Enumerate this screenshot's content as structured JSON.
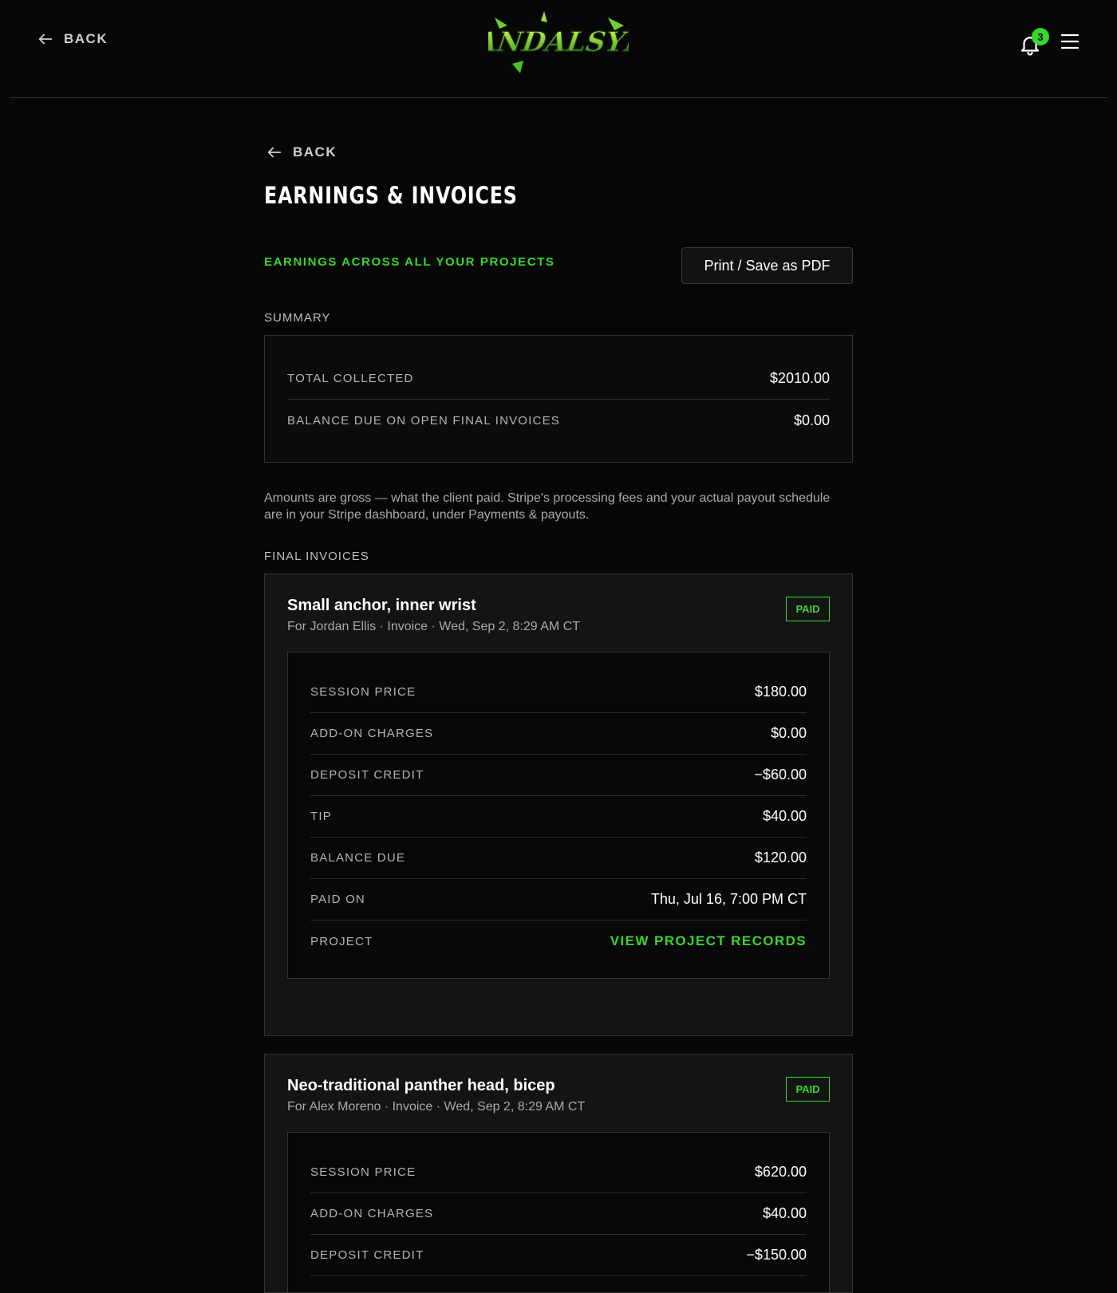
{
  "header": {
    "back_label": "BACK",
    "logo_text": "VANDALSYN",
    "notification_count": "3",
    "accent_color": "#39d531"
  },
  "page": {
    "back_label": "BACK",
    "title": "EARNINGS & INVOICES",
    "subtitle": "EARNINGS ACROSS ALL YOUR PROJECTS",
    "print_label": "Print / Save as PDF",
    "summary_label": "SUMMARY",
    "summary": [
      {
        "label": "TOTAL COLLECTED",
        "value": "$2010.00"
      },
      {
        "label": "BALANCE DUE ON OPEN FINAL INVOICES",
        "value": "$0.00"
      }
    ],
    "note": "Amounts are gross — what the client paid. Stripe's processing fees and your actual payout schedule are in your Stripe dashboard, under Payments & payouts.",
    "final_invoices_label": "FINAL INVOICES"
  },
  "invoices": [
    {
      "title": "Small anchor, inner wrist",
      "meta": "For Jordan Ellis · Invoice · Wed, Sep 2, 8:29 AM CT",
      "status": "PAID",
      "rows": [
        {
          "label": "SESSION PRICE",
          "value": "$180.00"
        },
        {
          "label": "ADD-ON CHARGES",
          "value": "$0.00"
        },
        {
          "label": "DEPOSIT CREDIT",
          "value": "−$60.00"
        },
        {
          "label": "TIP",
          "value": "$40.00"
        },
        {
          "label": "BALANCE DUE",
          "value": "$120.00"
        },
        {
          "label": "PAID ON",
          "value": "Thu, Jul 16, 7:00 PM CT"
        },
        {
          "label": "PROJECT",
          "value": "VIEW PROJECT RECORDS"
        }
      ]
    },
    {
      "title": "Neo-traditional panther head, bicep",
      "meta": "For Alex Moreno · Invoice · Wed, Sep 2, 8:29 AM CT",
      "status": "PAID",
      "rows": [
        {
          "label": "SESSION PRICE",
          "value": "$620.00"
        },
        {
          "label": "ADD-ON CHARGES",
          "value": "$40.00"
        },
        {
          "label": "DEPOSIT CREDIT",
          "value": "−$150.00"
        }
      ]
    }
  ]
}
